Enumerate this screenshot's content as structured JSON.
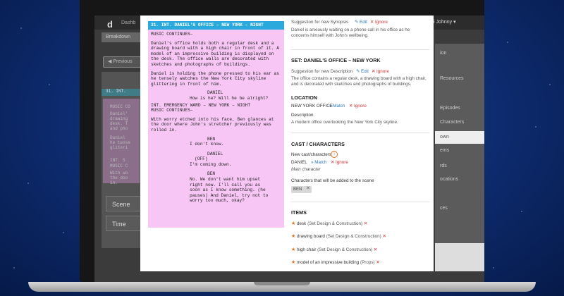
{
  "background_app": {
    "logo": "d",
    "nav_label": "Dashb",
    "user_menu": "Hi Johnny ▾",
    "tab_breakdown": "Breakdown",
    "previous_label": "◀ Previous",
    "behind_scene_heading": "31. INT.",
    "behind_fragments": [
      "MUSIC CO",
      "Daniel'",
      "drawing",
      "desk. T",
      "and pho",
      "Daniel",
      "he tense",
      "gliteri",
      "INT. S",
      "MUSIC C",
      "With wo",
      "the doo",
      "in."
    ],
    "scenes_button": "Scene",
    "timeline_button": "Time",
    "right_menu": [
      "ion",
      "Resources",
      "Episodes",
      "Characters",
      "own",
      "ems",
      "rds",
      "ocations",
      "ces"
    ]
  },
  "script": {
    "heading": "31. INT. DANIEL'S OFFICE – NEW YORK – NIGHT",
    "lines": [
      "MUSIC CONTINUES–",
      "Daniel's office holds both a regular desk and a drawing board with a high chair in front of it. A model of an impressive building is displayed on the desk. The office walls are decorated with sketches and photographs of buildings.",
      "Daniel is holding the phone pressed to his ear as he tensely watches the New York City skyline glittering in front of him."
    ],
    "char1": "DANIEL",
    "dial1": "How is he? Will he be alright?",
    "heading2": "INT. EMERGENCY WARD – NEW YORK – NIGHT",
    "music2": "MUSIC CONTINUES–",
    "action2": "With worry etched into his face, Ben glances at the door where John's stretcher previously was rolled in.",
    "char2": "BEN",
    "dial2": "I don't know.",
    "char3": "DANIEL",
    "paren3": "(OFF)",
    "dial3": "I'm coming down.",
    "char4": "BEN",
    "dial4": "No. We don't want him upset right now. I'll call you as soon as I know something. (he pauses) And Daniel, try not to worry too much, okay?"
  },
  "panel": {
    "synopsis_label": "Suggestion for new Synopsis",
    "edit": "✎ Edit",
    "ignore": "✕ Ignore",
    "synopsis_text": "Daniel is anxiously waiting on a phone call in his office as he concerns himself with John's wellbeing.",
    "set_heading": "SET: DANIEL'S OFFICE – NEW YORK",
    "desc_label": "Suggestion for new Description",
    "desc_text": "The office contains a regular desk, a drawing board with a high chair, and is decorated with sketches and photographs of buildings.",
    "location_heading": "LOCATION",
    "location_value": "NEW YORK OFFICE",
    "match": "» Match",
    "description_label": "Description",
    "location_desc": "A modern office overlooking the New York City skyline.",
    "cast_heading": "CAST / CHARACTERS",
    "new_cast_label": "New cast/characters",
    "info_icon_glyph": "i",
    "cast_name": "DANIEL",
    "cast_role": "Main character",
    "added_label": "Characters that will be added to the scene",
    "added_badge": "BEN",
    "items_heading": "ITEMS",
    "items": [
      {
        "name": "desk",
        "category": "(Set Design & Construction)"
      },
      {
        "name": "drawing board",
        "category": "(Set Design & Construction)"
      },
      {
        "name": "high chair",
        "category": "(Set Design & Construction)"
      },
      {
        "name": "model of an impressive building",
        "category": "(Props)"
      }
    ],
    "star_glyph": "★",
    "remove_glyph": "✕"
  },
  "colors": {
    "heading_blue": "#2aa9dd",
    "script_pink": "#f7c6f5",
    "link_blue": "#2a7ac0",
    "remove_red": "#cc3333",
    "star_orange": "#e07020"
  }
}
